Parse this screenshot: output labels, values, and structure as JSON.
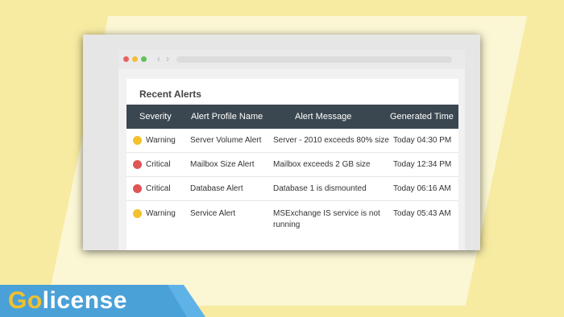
{
  "browser": {
    "nav_back": "‹",
    "nav_forward": "›"
  },
  "panel": {
    "title": "Recent Alerts",
    "columns": [
      "Severity",
      "Alert Profile Name",
      "Alert Message",
      "Generated Time"
    ],
    "rows": [
      {
        "severity": "Warning",
        "color": "#f2c12e",
        "profile": "Server Volume Alert",
        "message": "Server - 2010 exceeds 80% size",
        "time": "Today 04:30 PM"
      },
      {
        "severity": "Critical",
        "color": "#e05557",
        "profile": "Mailbox Size Alert",
        "message": "Mailbox exceeds 2 GB size",
        "time": "Today 12:34 PM"
      },
      {
        "severity": "Critical",
        "color": "#e05557",
        "profile": "Database Alert",
        "message": "Database 1 is dismounted",
        "time": "Today 06:16 AM"
      },
      {
        "severity": "Warning",
        "color": "#f2c12e",
        "profile": "Service Alert",
        "message": "MSExchange IS service is not running",
        "time": "Today 05:43 AM"
      }
    ]
  },
  "brand": {
    "first": "Go",
    "rest": "license"
  }
}
